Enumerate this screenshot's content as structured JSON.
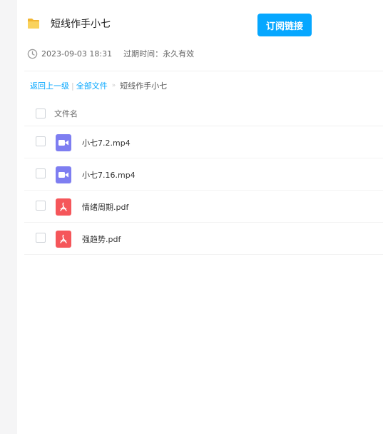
{
  "share": {
    "title": "短线作手小七",
    "subscribe_label": "订阅链接",
    "date": "2023-09-03 18:31",
    "expire_label": "过期时间：永久有效"
  },
  "breadcrumb": {
    "back": "返回上一级",
    "separator": "|",
    "all_files": "全部文件",
    "arrow": "»",
    "current": "短线作手小七"
  },
  "list": {
    "column_name": "文件名",
    "files": [
      {
        "name": "小七7.2.mp4",
        "type": "video-icon"
      },
      {
        "name": "小七7.16.mp4",
        "type": "video-icon"
      },
      {
        "name": "情绪周期.pdf",
        "type": "pdf-icon"
      },
      {
        "name": "强趋势.pdf",
        "type": "pdf-icon"
      }
    ]
  },
  "colors": {
    "accent": "#06a7ff",
    "video_icon": "#7e7ef1",
    "pdf_icon": "#f5565a",
    "folder": "#f7c548"
  }
}
